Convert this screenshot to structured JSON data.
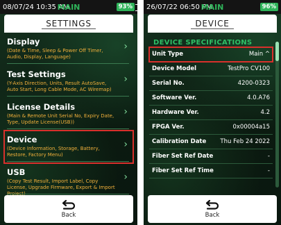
{
  "left": {
    "status": {
      "time": "08/07/24 10:35 AM",
      "mode": "MAIN",
      "battery": "93%"
    },
    "title": "SETTINGS",
    "menu": [
      {
        "label": "Display",
        "desc": "(Date & Time, Sleep & Power Off Timer, Audio, Display, Language)"
      },
      {
        "label": "Test Settings",
        "desc": "(Y-Axis Direction, Units, Result AutoSave, Auto Start, Long Cable Mode, AC Wiremap)"
      },
      {
        "label": "License Details",
        "desc": "(Main & Remote Unit Serial No, Expiry Date, Type, Update License(USB))"
      },
      {
        "label": "Device",
        "desc": "(Device Information, Storage, Battery, Restore, Factory Menu)"
      },
      {
        "label": "USB",
        "desc": "(Copy Test Result, Import Label, Copy License, Upgrade Firmware, Export & Import Project)"
      }
    ],
    "back_label": "Back"
  },
  "right": {
    "status": {
      "time": "26/07/22 06:50 PM",
      "mode": "MAIN",
      "battery": "96%"
    },
    "title": "DEVICE",
    "section_header": "DEVICE SPECIFICATIONS",
    "specs": [
      {
        "key": "Unit Type",
        "value": "Main ^"
      },
      {
        "key": "Device Model",
        "value": "TestPro CV100"
      },
      {
        "key": "Serial No.",
        "value": "4200-0323"
      },
      {
        "key": "Software Ver.",
        "value": "4.0.A76"
      },
      {
        "key": "Hardware Ver.",
        "value": "4.2"
      },
      {
        "key": "FPGA Ver.",
        "value": "0x00004a15"
      },
      {
        "key": "Calibration Date",
        "value": "Thu Feb 24 2022"
      },
      {
        "key": "Fiber Set Ref Date",
        "value": "-"
      },
      {
        "key": "Fiber Set Ref Time",
        "value": "-"
      }
    ],
    "back_label": "Back"
  },
  "colors": {
    "accent_green": "#2fb45a",
    "highlight_red": "#d9302c",
    "desc_orange": "#f3b13b"
  },
  "icons": {
    "back": "undo-arrow-icon",
    "chevron": "chevron-right-icon"
  }
}
